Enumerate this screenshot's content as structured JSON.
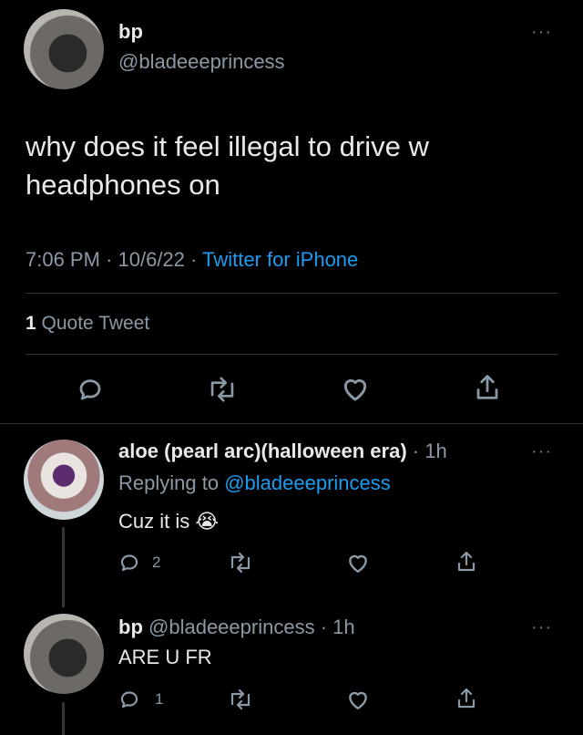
{
  "main_tweet": {
    "display_name": "bp",
    "handle": "@bladeeeprincess",
    "text_line1": "why does it feel illegal to drive w",
    "text_line2": "headphones on",
    "time": "7:06 PM",
    "sep1": "·",
    "date": "10/6/22",
    "sep2": "·",
    "source": "Twitter for iPhone",
    "quote_count": "1",
    "quote_label": "Quote Tweet",
    "more": "···"
  },
  "reply1": {
    "display_name": "aloe (pearl arc)(halloween era)",
    "meta": "· 1h",
    "replying_prefix": "Replying to",
    "replying_handle": "@bladeeeprincess",
    "text": "Cuz it is",
    "emoji": "😭",
    "reply_count": "2",
    "more": "···"
  },
  "reply2": {
    "display_name": "bp",
    "handle": "@bladeeeprincess",
    "meta": "· 1h",
    "text": "ARE U FR",
    "reply_count": "1",
    "more": "···"
  },
  "icons": [
    "reply-icon",
    "retweet-icon",
    "like-icon",
    "share-icon",
    "more-icon"
  ],
  "colors": {
    "background": "#000000",
    "text": "#e7e9ea",
    "secondary": "#8b98a5",
    "link": "#1d9bf0",
    "divider": "#2f3336"
  }
}
